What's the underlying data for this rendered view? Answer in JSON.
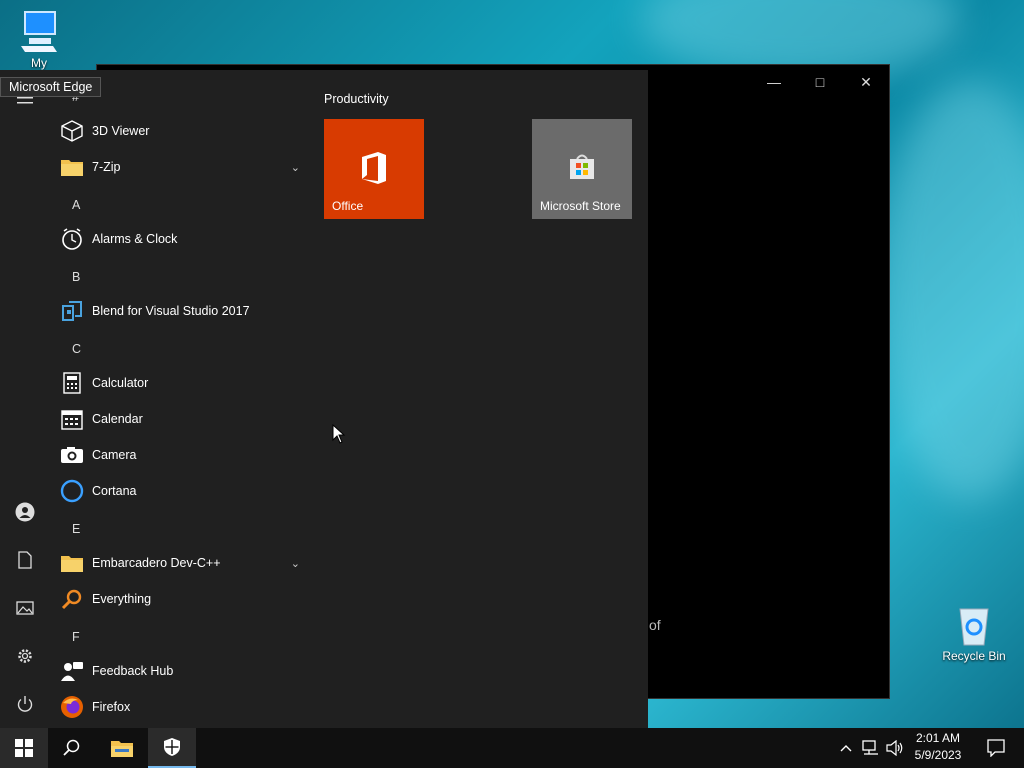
{
  "desktop": {
    "icons": [
      {
        "label": "My Computer"
      },
      {
        "label": "Recycle Bin"
      }
    ]
  },
  "tooltip": {
    "text": "Microsoft Edge"
  },
  "window": {
    "partial_text": "of"
  },
  "start_menu": {
    "sections": {
      "hash": "#",
      "a": "A",
      "b": "B",
      "c": "C",
      "e": "E",
      "f": "F"
    },
    "apps": [
      {
        "label": "3D Viewer",
        "icon": "cube-icon"
      },
      {
        "label": "7-Zip",
        "icon": "folder-icon",
        "expandable": true
      },
      {
        "label": "Alarms & Clock",
        "icon": "clock-icon"
      },
      {
        "label": "Blend for Visual Studio 2017",
        "icon": "blend-icon"
      },
      {
        "label": "Calculator",
        "icon": "calculator-icon"
      },
      {
        "label": "Calendar",
        "icon": "calendar-icon"
      },
      {
        "label": "Camera",
        "icon": "camera-icon"
      },
      {
        "label": "Cortana",
        "icon": "cortana-icon"
      },
      {
        "label": "Embarcadero Dev-C++",
        "icon": "folder-icon",
        "expandable": true
      },
      {
        "label": "Everything",
        "icon": "magnifier-icon"
      },
      {
        "label": "Feedback Hub",
        "icon": "feedback-icon"
      },
      {
        "label": "Firefox",
        "icon": "firefox-icon"
      }
    ],
    "tiles_group_title": "Productivity",
    "tiles": [
      {
        "label": "Office",
        "color": "#d83b01"
      },
      {
        "label": "Microsoft Store",
        "color": "#6b6b6b"
      }
    ]
  },
  "taskbar": {
    "clock_time": "2:01 AM",
    "clock_date": "5/9/2023"
  },
  "colors": {
    "accent": "#0078d7",
    "start_bg": "#202020",
    "taskbar_bg": "#101010"
  }
}
